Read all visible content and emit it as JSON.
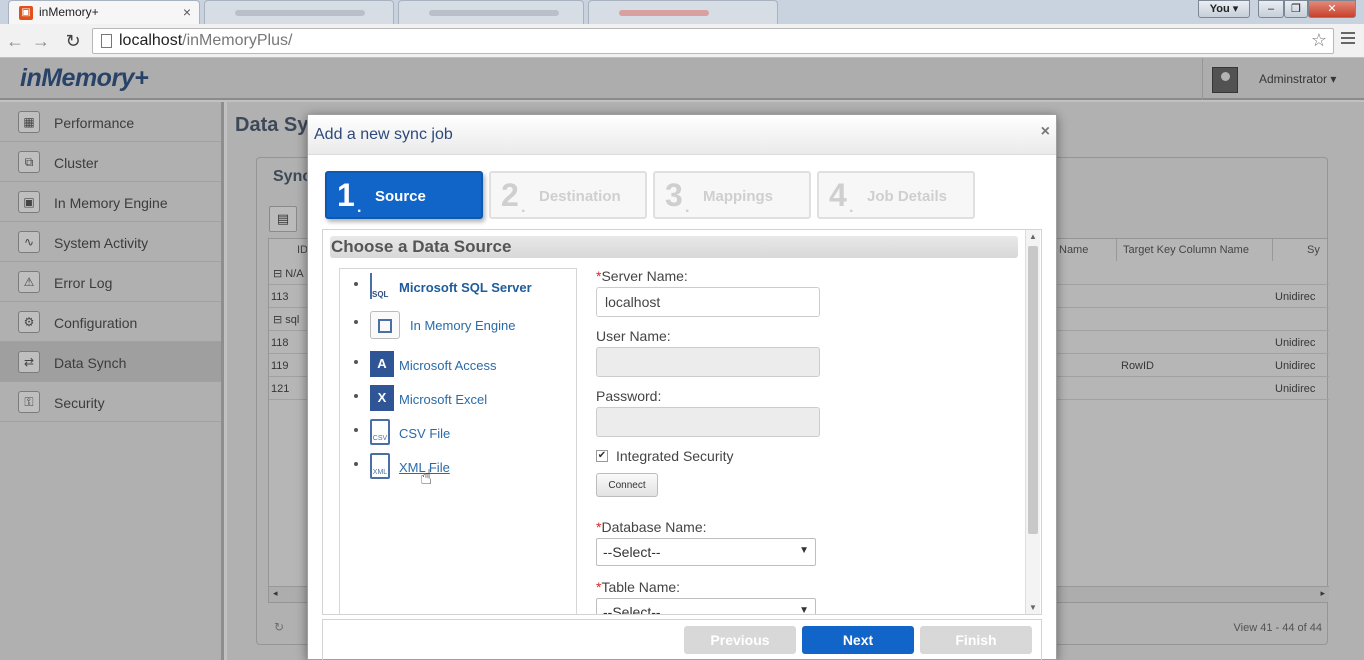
{
  "browser": {
    "active_tab_title": "inMemory+",
    "url_host": "localhost",
    "url_path": "/inMemoryPlus/",
    "profile_button": "You"
  },
  "app": {
    "logo": "inMemory+",
    "user": "Adminstrator ▾"
  },
  "sidebar": {
    "items": [
      {
        "label": "Performance",
        "icon": "performance-icon"
      },
      {
        "label": "Cluster",
        "icon": "cluster-icon"
      },
      {
        "label": "In Memory Engine",
        "icon": "chip-icon"
      },
      {
        "label": "System Activity",
        "icon": "activity-icon"
      },
      {
        "label": "Error Log",
        "icon": "warning-icon"
      },
      {
        "label": "Configuration",
        "icon": "gear-icon"
      },
      {
        "label": "Data Synch",
        "icon": "sync-icon"
      },
      {
        "label": "Security",
        "icon": "key-icon"
      }
    ],
    "active_index": 6
  },
  "content": {
    "title": "Data Sy",
    "panel_title": "Sync",
    "grid": {
      "headers": [
        "ID",
        "Name",
        "Target Key Column Name",
        "Sy"
      ],
      "group1": "⊟ N/A",
      "group2": "⊟ sql",
      "rows": [
        {
          "id": "113",
          "target_key": "",
          "sync": "Unidirec"
        },
        {
          "id": "118",
          "target_key": "",
          "sync": "Unidirec"
        },
        {
          "id": "119",
          "target_key": "RowID",
          "sync": "Unidirec"
        },
        {
          "id": "121",
          "target_key": "",
          "sync": "Unidirec"
        }
      ],
      "pager_text": "View 41 - 44 of 44"
    }
  },
  "modal": {
    "title": "Add a new sync job",
    "steps": [
      {
        "num": "1",
        "label": "Source"
      },
      {
        "num": "2",
        "label": "Destination"
      },
      {
        "num": "3",
        "label": "Mappings"
      },
      {
        "num": "4",
        "label": "Job Details"
      }
    ],
    "section_title": "Choose a Data Source",
    "sources": [
      {
        "label": "Microsoft SQL Server",
        "icon": "sql-server-icon",
        "icon_text": "SQL"
      },
      {
        "label": "In Memory Engine",
        "icon": "chip-icon",
        "icon_text": ""
      },
      {
        "label": "Microsoft Access",
        "icon": "access-icon",
        "icon_text": "A"
      },
      {
        "label": "Microsoft Excel",
        "icon": "excel-icon",
        "icon_text": "X"
      },
      {
        "label": "CSV File",
        "icon": "csv-file-icon",
        "icon_text": "CSV"
      },
      {
        "label": "XML File",
        "icon": "xml-file-icon",
        "icon_text": "XML"
      }
    ],
    "form": {
      "server_name_label": "Server Name:",
      "server_name_value": "localhost",
      "user_name_label": "User Name:",
      "password_label": "Password:",
      "integrated_security_label": "Integrated Security",
      "integrated_security_checked": true,
      "connect_label": "Connect",
      "database_name_label": "Database Name:",
      "database_select": "--Select--",
      "table_name_label": "Table Name:",
      "table_select": "--Select--"
    },
    "buttons": {
      "previous": "Previous",
      "next": "Next",
      "finish": "Finish"
    }
  }
}
